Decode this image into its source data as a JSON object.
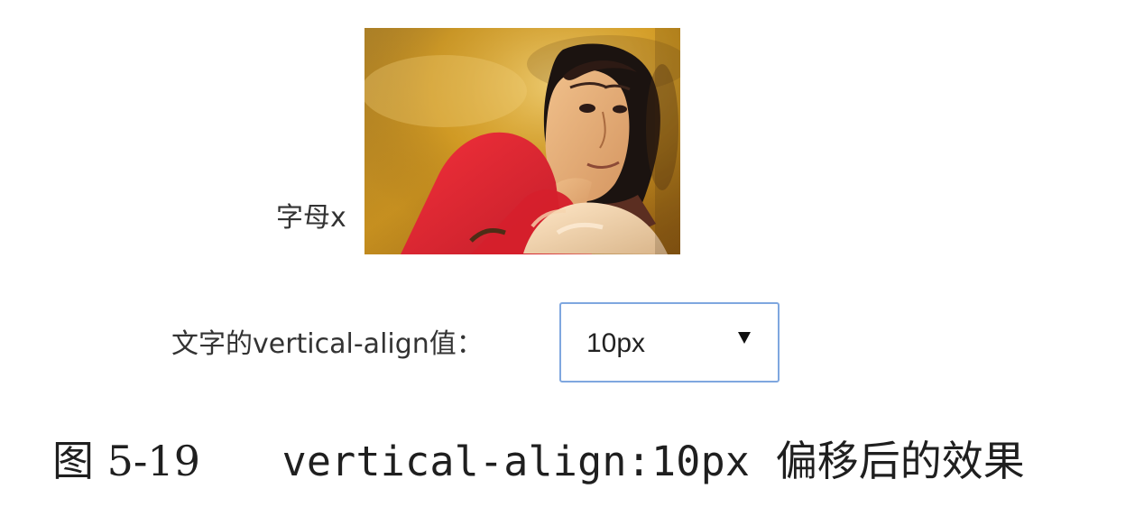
{
  "demo": {
    "inline_text": "字母x",
    "photo_icon": "portrait-photo"
  },
  "control": {
    "label": "文字的vertical-align值：",
    "selected_value": "10px",
    "arrow_icon": "triangle-down"
  },
  "caption": {
    "figure_number": "图 5-19",
    "code": "vertical-align:10px",
    "description": "偏移后的效果"
  }
}
